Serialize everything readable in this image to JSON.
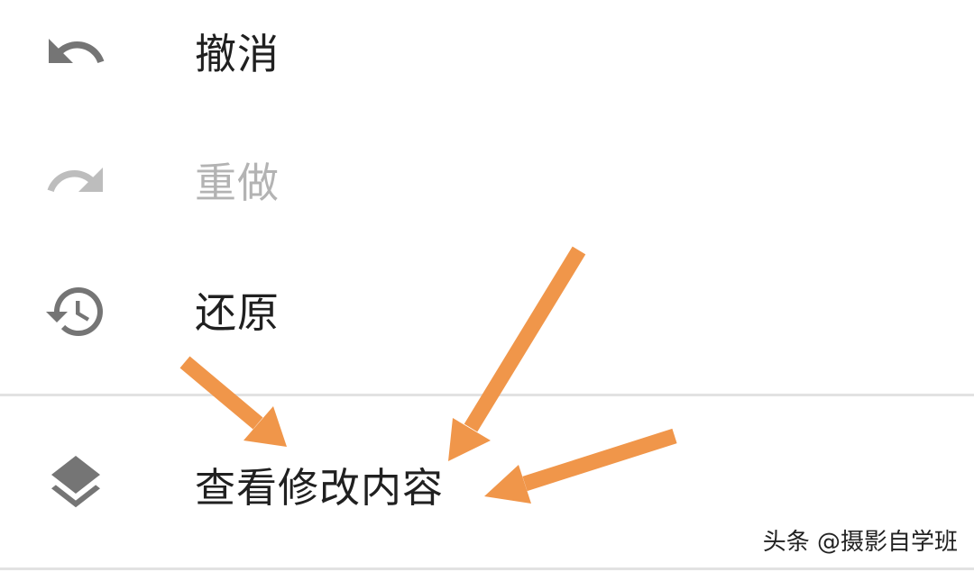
{
  "menu": {
    "items": [
      {
        "label": "撤消",
        "icon": "undo-icon",
        "enabled": true
      },
      {
        "label": "重做",
        "icon": "redo-icon",
        "enabled": false
      },
      {
        "label": "还原",
        "icon": "history-restore-icon",
        "enabled": true
      },
      {
        "label": "查看修改内容",
        "icon": "layers-icon",
        "enabled": true
      }
    ]
  },
  "annotations": {
    "arrow_color": "#f0964a",
    "arrow_count": 3
  },
  "watermark": {
    "text": "头条 @摄影自学班"
  },
  "colors": {
    "text_enabled": "#202020",
    "text_disabled": "#b3b3b3",
    "icon_enabled": "#757575",
    "icon_disabled": "#bdbdbd",
    "divider": "#e2e2e2",
    "background": "#ffffff"
  }
}
